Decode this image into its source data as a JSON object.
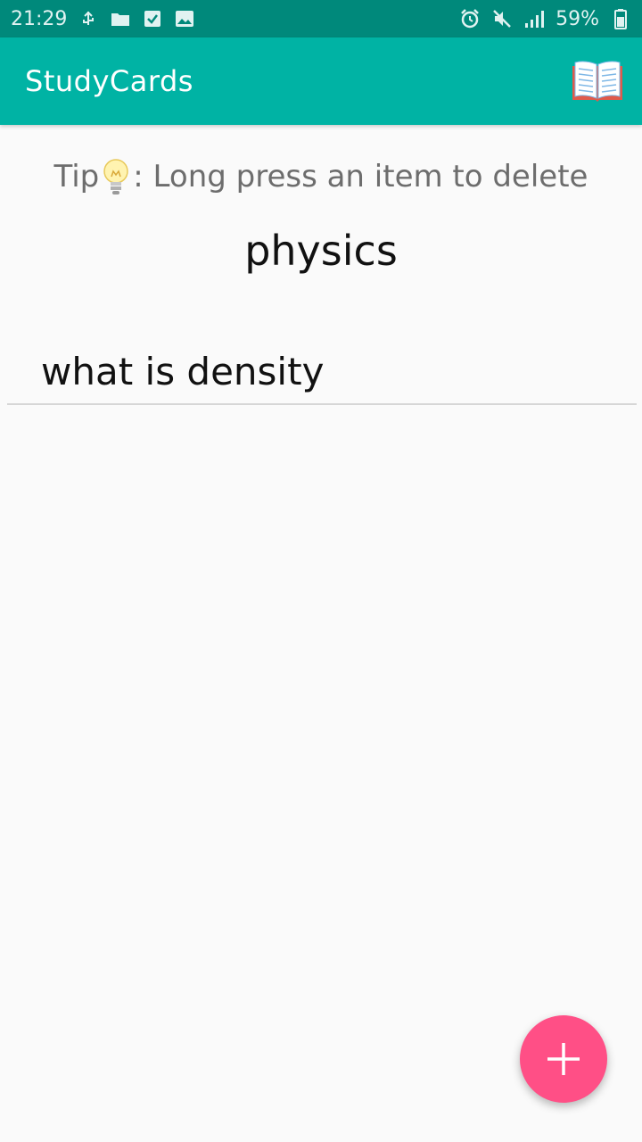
{
  "status_bar": {
    "time": "21:29",
    "battery": "59%",
    "icons_left": [
      "usb-icon",
      "folder-icon",
      "checkbox-icon",
      "image-icon"
    ],
    "icons_right": [
      "alarm-icon",
      "mute-icon",
      "signal-icon",
      "battery-icon"
    ]
  },
  "app_bar": {
    "title": "StudyCards",
    "menu_icon": "open-book-icon"
  },
  "tip": {
    "prefix": "Tip",
    "icon": "light-bulb-icon",
    "text": ": Long press an item to delete"
  },
  "deck": {
    "title": "physics"
  },
  "cards": [
    {
      "question": "what is density"
    }
  ],
  "fab": {
    "icon": "plus-icon",
    "color": "#ff4f86"
  },
  "colors": {
    "status_bar": "#00897b",
    "app_bar": "#00b3a4",
    "background": "#fafafa"
  }
}
